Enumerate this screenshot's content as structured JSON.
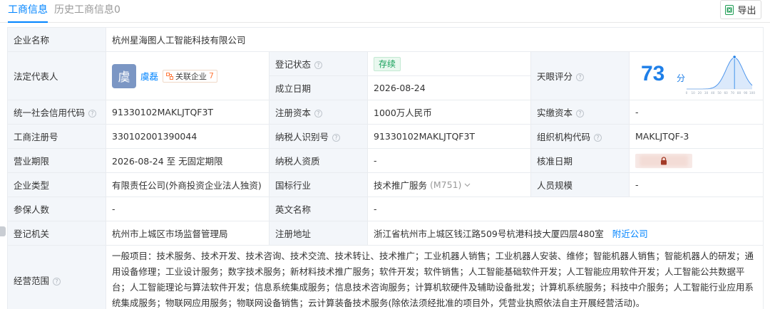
{
  "tabs": [
    {
      "label": "工商信息"
    },
    {
      "label": "历史工商信息0"
    }
  ],
  "export_label": "导出",
  "company": {
    "name_label": "企业名称",
    "name": "杭州星海图人工智能科技有限公司",
    "legal_rep_label": "法定代表人",
    "legal_rep_avatar": "虞",
    "legal_rep_name": "虞磊",
    "assoc_label": "关联企业",
    "assoc_count": "7",
    "reg_status_label": "登记状态",
    "reg_status": "存续",
    "founded_label": "成立日期",
    "founded": "2026-08-24",
    "tianyan_label": "天眼评分",
    "tianyan_score": "73",
    "tianyan_unit": "分",
    "credit_code_label": "统一社会信用代码",
    "credit_code": "91330102MAKLJTQF3T",
    "reg_capital_label": "注册资本",
    "reg_capital": "1000万人民币",
    "paid_capital_label": "实缴资本",
    "paid_capital": "-",
    "biz_reg_no_label": "工商注册号",
    "biz_reg_no": "330102001390044",
    "taxpayer_id_label": "纳税人识别号",
    "taxpayer_id": "91330102MAKLJTQF3T",
    "org_code_label": "组织机构代码",
    "org_code": "MAKLJTQF-3",
    "term_label": "营业期限",
    "term": "2026-08-24 至 无固定期限",
    "taxpayer_qual_label": "纳税人资质",
    "taxpayer_qual": "-",
    "approval_date_label": "核准日期",
    "type_label": "企业类型",
    "type": "有限责任公司(外商投资企业法人独资)",
    "industry_label": "国标行业",
    "industry": "技术推广服务",
    "industry_code": "(M751)",
    "staff_label": "人员规模",
    "staff": "-",
    "insured_label": "参保人数",
    "insured": "-",
    "en_name_label": "英文名称",
    "en_name": "-",
    "authority_label": "登记机关",
    "authority": "杭州市上城区市场监督管理局",
    "address_label": "注册地址",
    "address": "浙江省杭州市上城区钱江路509号杭港科技大厦四层480室",
    "nearby_label": "附近公司",
    "scope_label": "经营范围",
    "scope": "一般项目：技术服务、技术开发、技术咨询、技术交流、技术转让、技术推广；工业机器人销售；工业机器人安装、维修；智能机器人销售；智能机器人的研发；通用设备修理；工业设计服务；数字技术服务；新材料技术推广服务；软件开发；软件销售；人工智能基础软件开发；人工智能应用软件开发；人工智能公共数据平台；人工智能理论与算法软件开发；信息系统集成服务；信息技术咨询服务；计算机软硬件及辅助设备批发；计算机系统服务；科技中介服务；人工智能行业应用系统集成服务；物联网应用服务；物联网设备销售；云计算装备技术服务(除依法须经批准的项目外，凭营业执照依法自主开展经营活动)。"
  },
  "score_chart": {
    "ticks": [
      "0",
      "10",
      "20",
      "30",
      "40",
      "50",
      "60",
      "70",
      "80",
      "90",
      "100"
    ],
    "marker": 73
  },
  "colors": {
    "accent": "#0084ff",
    "score": "#1e7fe8",
    "status_green": "#16a05a",
    "assoc_orange": "#ff7a3d"
  }
}
